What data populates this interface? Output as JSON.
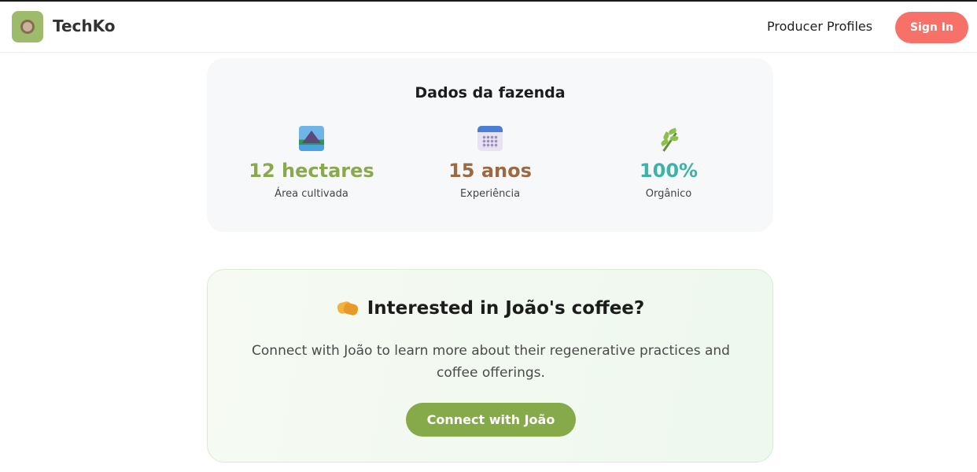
{
  "header": {
    "brand": "TechKo",
    "nav_link": "Producer Profiles",
    "signin_label": "Sign In"
  },
  "farm": {
    "title": "Dados da fazenda",
    "stats": [
      {
        "value": "12 hectares",
        "label": "Área cultivada",
        "icon": "landscape-icon",
        "color": "#8aa84e"
      },
      {
        "value": "15 anos",
        "label": "Experiência",
        "icon": "calendar-icon",
        "color": "#9b6a42"
      },
      {
        "value": "100%",
        "label": "Orgânico",
        "icon": "leaf-icon",
        "color": "#3db3a6"
      }
    ]
  },
  "cta": {
    "icon": "handshake-icon",
    "title": "Interested in João's coffee?",
    "description": "Connect with João to learn more about their regenerative practices and coffee offerings.",
    "button_label": "Connect with João"
  },
  "colors": {
    "accent_green": "#86a94a",
    "signin_coral": "#f87168",
    "logo_bg": "#9dbb6a"
  }
}
